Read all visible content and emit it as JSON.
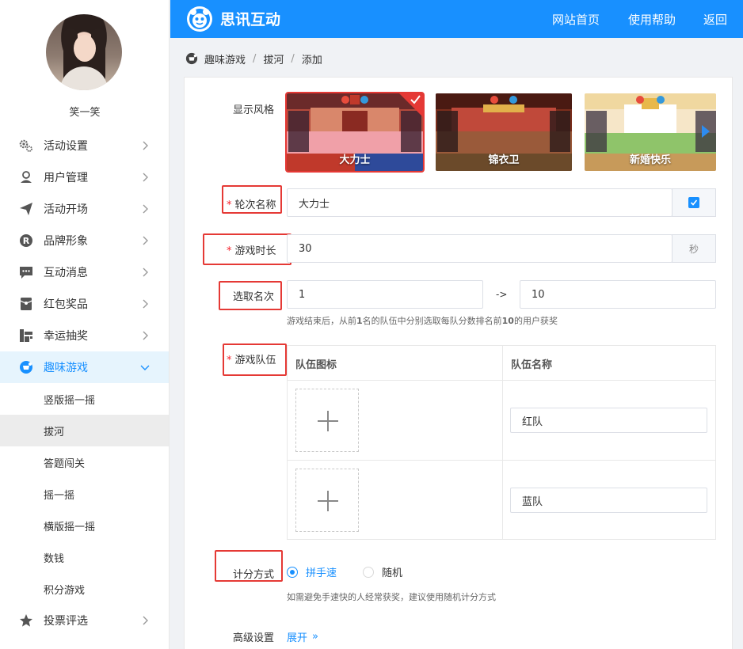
{
  "sidebar": {
    "username": "笑一笑",
    "menu": [
      {
        "label": "活动设置",
        "icon": "gears-icon"
      },
      {
        "label": "用户管理",
        "icon": "user-icon"
      },
      {
        "label": "活动开场",
        "icon": "paper-plane-icon"
      },
      {
        "label": "品牌形象",
        "icon": "registered-icon"
      },
      {
        "label": "互动消息",
        "icon": "chat-bubble-icon"
      },
      {
        "label": "红包奖品",
        "icon": "red-envelope-icon"
      },
      {
        "label": "幸运抽奖",
        "icon": "lottery-icon"
      },
      {
        "label": "趣味游戏",
        "icon": "gamepad-icon"
      }
    ],
    "submenu": [
      "竖版摇一摇",
      "拔河",
      "答题闯关",
      "摇一摇",
      "横版摇一摇",
      "数钱",
      "积分游戏"
    ],
    "after_menu": [
      {
        "label": "投票评选",
        "icon": "star-icon"
      }
    ]
  },
  "header": {
    "brand": "思讯互动",
    "links": [
      "网站首页",
      "使用帮助",
      "返回"
    ]
  },
  "breadcrumb": [
    "趣味游戏",
    "拔河",
    "添加"
  ],
  "form": {
    "style_label": "显示风格",
    "styles": [
      "大力士",
      "锦衣卫",
      "新婚快乐"
    ],
    "round_label": "轮次名称",
    "round_value": "大力士",
    "duration_label": "游戏时长",
    "duration_value": "30",
    "duration_unit": "秒",
    "rank_label": "选取名次",
    "rank_from": "1",
    "rank_arrow": "->",
    "rank_to": "10",
    "rank_hint_a": "游戏结束后，从前",
    "rank_hint_b": "1",
    "rank_hint_c": "名的队伍中分别选取每队分数排名前",
    "rank_hint_d": "10",
    "rank_hint_e": "的用户获奖",
    "team_label": "游戏队伍",
    "team_col_icon": "队伍图标",
    "team_col_name": "队伍名称",
    "teams": [
      "红队",
      "蓝队"
    ],
    "score_label": "计分方式",
    "score_options": [
      "拼手速",
      "随机"
    ],
    "score_hint": "如需避免手速快的人经常获奖，建议使用随机计分方式",
    "advanced_label": "高级设置",
    "advanced_link": "展开",
    "advanced_chevron": "»"
  },
  "colors": {
    "primary": "#1890ff",
    "highlight": "#e53935",
    "required": "#f5222d"
  }
}
